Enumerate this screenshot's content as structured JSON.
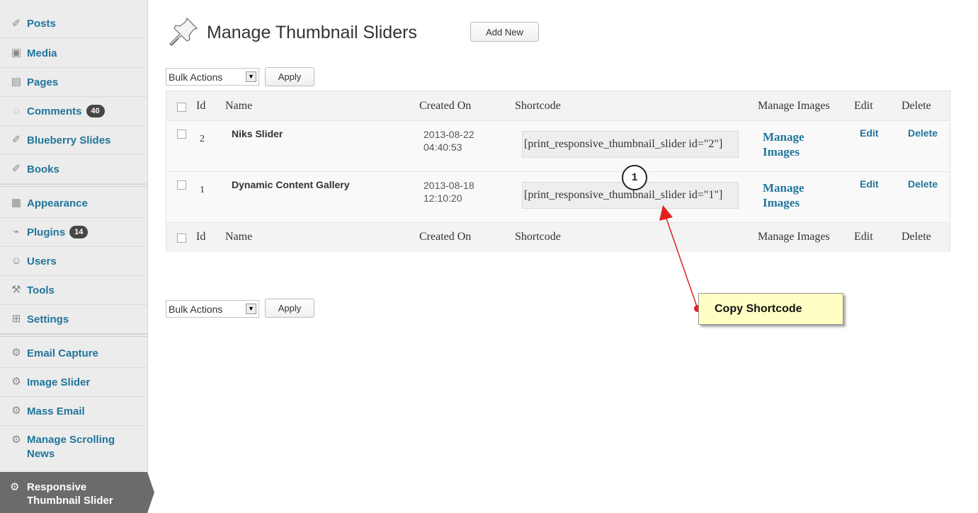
{
  "sidebar": {
    "items": [
      {
        "label": "Posts",
        "icon": "pin-icon"
      },
      {
        "label": "Media",
        "icon": "media-icon"
      },
      {
        "label": "Pages",
        "icon": "pages-icon"
      },
      {
        "label": "Comments",
        "icon": "comments-icon",
        "count": "40"
      },
      {
        "label": "Blueberry Slides",
        "icon": "pin-icon"
      },
      {
        "label": "Books",
        "icon": "pin-icon"
      },
      {
        "label": "Appearance",
        "icon": "appearance-icon"
      },
      {
        "label": "Plugins",
        "icon": "plugins-icon",
        "count": "14"
      },
      {
        "label": "Users",
        "icon": "users-icon"
      },
      {
        "label": "Tools",
        "icon": "tools-icon"
      },
      {
        "label": "Settings",
        "icon": "settings-icon"
      },
      {
        "label": "Email Capture",
        "icon": "gear-icon"
      },
      {
        "label": "Image Slider",
        "icon": "gear-icon"
      },
      {
        "label": "Mass Email",
        "icon": "gear-icon"
      },
      {
        "label": "Manage Scrolling News",
        "line1": "Manage Scrolling",
        "line2": "News",
        "icon": "gear-icon"
      }
    ],
    "active": {
      "line1": "Responsive",
      "line2": "Thumbnail Slider",
      "icon": "gear-icon"
    }
  },
  "header": {
    "title": "Manage Thumbnail Sliders",
    "add_new": "Add New"
  },
  "bulk_top": {
    "selected": "Bulk Actions",
    "apply": "Apply"
  },
  "bulk_bottom": {
    "selected": "Bulk Actions",
    "apply": "Apply"
  },
  "table": {
    "columns": [
      "Id",
      "Name",
      "Created On",
      "Shortcode",
      "Manage Images",
      "Edit",
      "Delete"
    ],
    "rows": [
      {
        "id": "2",
        "name": "Niks Slider",
        "date": "2013-08-22",
        "time": "04:40:53",
        "shortcode": "[print_responsive_thumbnail_slider id=\"2\"]",
        "manage1": "Manage",
        "manage2": "Images",
        "edit": "Edit",
        "delete": "Delete"
      },
      {
        "id": "1",
        "name": "Dynamic Content Gallery",
        "date": "2013-08-18",
        "time": "12:10:20",
        "shortcode": "[print_responsive_thumbnail_slider id=\"1\"]",
        "manage1": "Manage",
        "manage2": "Images",
        "edit": "Edit",
        "delete": "Delete"
      }
    ]
  },
  "annotation": {
    "number": "1",
    "label": "Copy Shortcode"
  },
  "colors": {
    "link": "#21759b",
    "sidebar_bg": "#ececec",
    "active_bg": "#6b6b6b",
    "callout_bg": "#ffffc4",
    "arrow": "#e0201e"
  }
}
